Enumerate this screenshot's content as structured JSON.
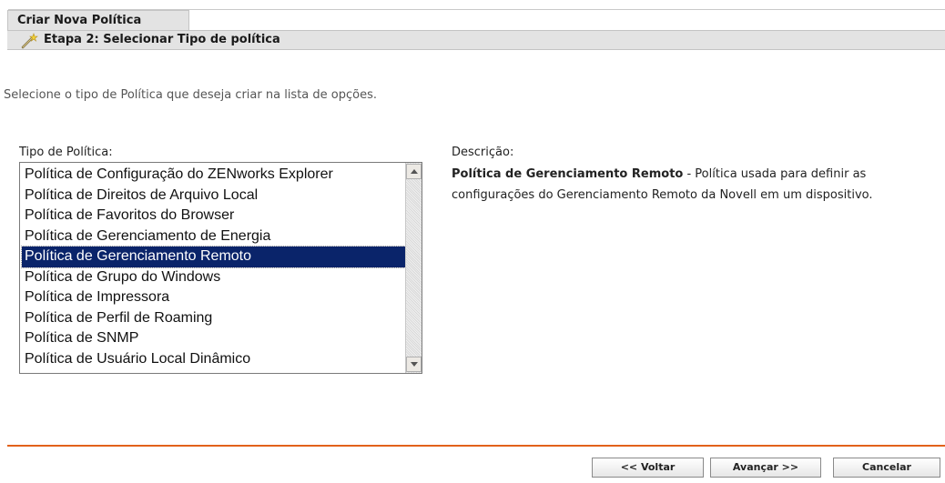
{
  "header": {
    "tab_title": "Criar Nova Política",
    "step_title": "Etapa 2: Selecionar Tipo de política",
    "step_icon": "wand-icon"
  },
  "instruction": "Selecione o tipo de Política que deseja criar na lista de opções.",
  "policy_type": {
    "label": "Tipo de Política:",
    "items": [
      "Política de Configuração do ZENworks Explorer",
      "Política de Direitos de Arquivo Local",
      "Política de Favoritos do Browser",
      "Política de Gerenciamento de Energia",
      "Política de Gerenciamento Remoto",
      "Política de Grupo do Windows",
      "Política de Impressora",
      "Política de Perfil de Roaming",
      "Política de SNMP",
      "Política de Usuário Local Dinâmico"
    ],
    "selected": "Política de Gerenciamento Remoto"
  },
  "description": {
    "label": "Descrição:",
    "title": "Política de Gerenciamento Remoto",
    "text": " - Política usada para definir as configurações do Gerenciamento Remoto da Novell em um dispositivo."
  },
  "buttons": {
    "back": "<< Voltar",
    "next": "Avançar >>",
    "cancel": "Cancelar"
  },
  "colors": {
    "selection": "#0a246a",
    "divider": "#e2621b",
    "header_bg": "#e3e3e3"
  }
}
